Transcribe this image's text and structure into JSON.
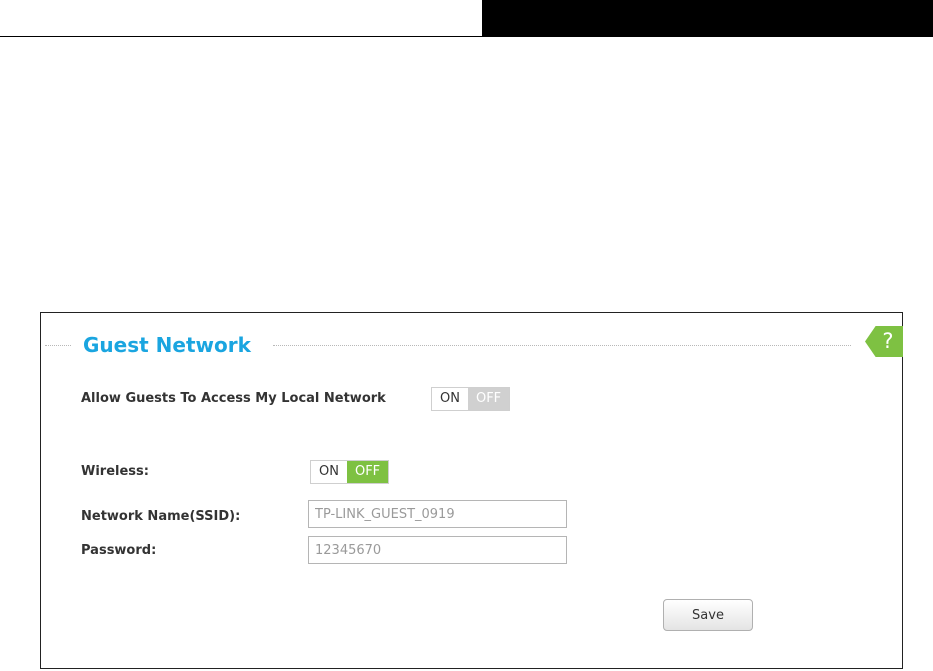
{
  "section": {
    "title": "Guest Network",
    "help_icon": "question-mark-icon",
    "help_glyph": "?"
  },
  "allow_local_access": {
    "label": "Allow Guests To Access My Local Network",
    "on_label": "ON",
    "off_label": "OFF",
    "state": "on"
  },
  "wireless": {
    "label": "Wireless:",
    "on_label": "ON",
    "off_label": "OFF",
    "state": "on"
  },
  "ssid": {
    "label": "Network Name(SSID):",
    "value": "TP-LINK_GUEST_0919"
  },
  "password": {
    "label": "Password:",
    "value": "12345670"
  },
  "save_label": "Save",
  "colors": {
    "title_blue": "#1aa5e0",
    "accent_green": "#7ec142",
    "inactive_gray": "#d0d0d0"
  }
}
